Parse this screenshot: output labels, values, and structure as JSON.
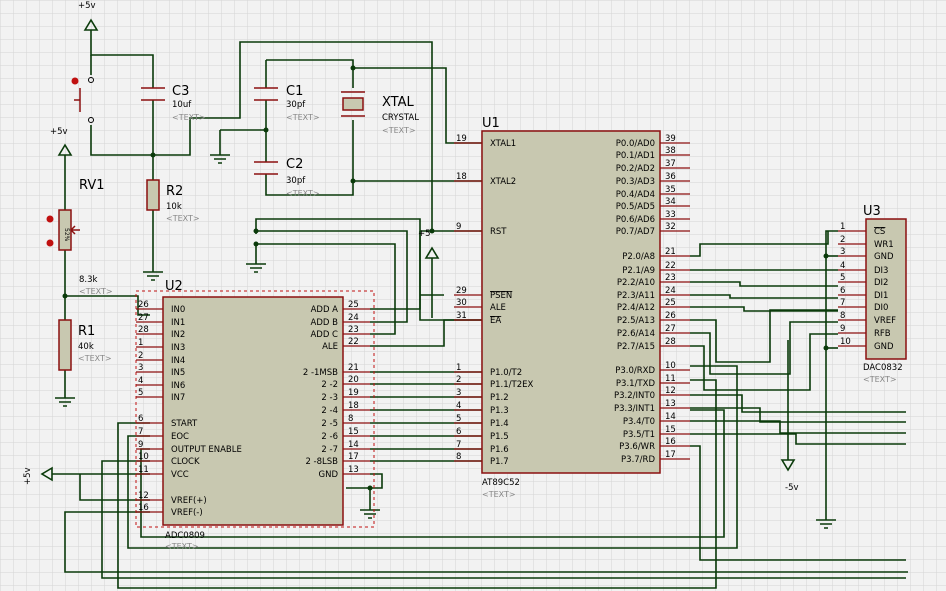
{
  "schematic": {
    "u1": {
      "ref": "U1",
      "part": "AT89C52",
      "text": "<TEXT>",
      "left_pins": [
        {
          "num": "19",
          "label": "XTAL1"
        },
        {
          "num": "18",
          "label": "XTAL2"
        },
        {
          "num": "9",
          "label": "RST"
        },
        {
          "num": "29",
          "label": "PSEN"
        },
        {
          "num": "30",
          "label": "ALE"
        },
        {
          "num": "31",
          "label": "EA"
        },
        {
          "num": "1",
          "label": "P1.0/T2"
        },
        {
          "num": "2",
          "label": "P1.1/T2EX"
        },
        {
          "num": "3",
          "label": "P1.2"
        },
        {
          "num": "4",
          "label": "P1.3"
        },
        {
          "num": "5",
          "label": "P1.4"
        },
        {
          "num": "6",
          "label": "P1.5"
        },
        {
          "num": "7",
          "label": "P1.6"
        },
        {
          "num": "8",
          "label": "P1.7"
        }
      ],
      "right_pins": [
        {
          "num": "39",
          "label": "P0.0/AD0"
        },
        {
          "num": "38",
          "label": "P0.1/AD1"
        },
        {
          "num": "37",
          "label": "P0.2/AD2"
        },
        {
          "num": "36",
          "label": "P0.3/AD3"
        },
        {
          "num": "35",
          "label": "P0.4/AD4"
        },
        {
          "num": "34",
          "label": "P0.5/AD5"
        },
        {
          "num": "33",
          "label": "P0.6/AD6"
        },
        {
          "num": "32",
          "label": "P0.7/AD7"
        },
        {
          "num": "21",
          "label": "P2.0/A8"
        },
        {
          "num": "22",
          "label": "P2.1/A9"
        },
        {
          "num": "23",
          "label": "P2.2/A10"
        },
        {
          "num": "24",
          "label": "P2.3/A11"
        },
        {
          "num": "25",
          "label": "P2.4/A12"
        },
        {
          "num": "26",
          "label": "P2.5/A13"
        },
        {
          "num": "27",
          "label": "P2.6/A14"
        },
        {
          "num": "28",
          "label": "P2.7/A15"
        },
        {
          "num": "10",
          "label": "P3.0/RXD"
        },
        {
          "num": "11",
          "label": "P3.1/TXD"
        },
        {
          "num": "12",
          "label": "P3.2/INT0"
        },
        {
          "num": "13",
          "label": "P3.3/INT1"
        },
        {
          "num": "14",
          "label": "P3.4/T0"
        },
        {
          "num": "15",
          "label": "P3.5/T1"
        },
        {
          "num": "16",
          "label": "P3.6/WR"
        },
        {
          "num": "17",
          "label": "P3.7/RD"
        }
      ]
    },
    "u2": {
      "ref": "U2",
      "part": "ADC0809",
      "text": "<TEXT>",
      "left_pins": [
        {
          "num": "26",
          "label": "IN0"
        },
        {
          "num": "27",
          "label": "IN1"
        },
        {
          "num": "28",
          "label": "IN2"
        },
        {
          "num": "1",
          "label": "IN3"
        },
        {
          "num": "2",
          "label": "IN4"
        },
        {
          "num": "3",
          "label": "IN5"
        },
        {
          "num": "4",
          "label": "IN6"
        },
        {
          "num": "5",
          "label": "IN7"
        },
        {
          "num": "6",
          "label": "START"
        },
        {
          "num": "7",
          "label": "EOC"
        },
        {
          "num": "9",
          "label": "OUTPUT ENABLE"
        },
        {
          "num": "10",
          "label": "CLOCK"
        },
        {
          "num": "11",
          "label": "VCC"
        },
        {
          "num": "12",
          "label": "VREF(+)"
        },
        {
          "num": "16",
          "label": "VREF(-)"
        }
      ],
      "right_pins": [
        {
          "num": "25",
          "label": "ADD A"
        },
        {
          "num": "24",
          "label": "ADD B"
        },
        {
          "num": "23",
          "label": "ADD C"
        },
        {
          "num": "22",
          "label": "ALE"
        },
        {
          "num": "21",
          "label": "2 -1MSB"
        },
        {
          "num": "20",
          "label": "2 -2"
        },
        {
          "num": "19",
          "label": "2 -3"
        },
        {
          "num": "18",
          "label": "2 -4"
        },
        {
          "num": "8",
          "label": "2 -5"
        },
        {
          "num": "15",
          "label": "2 -6"
        },
        {
          "num": "14",
          "label": "2 -7"
        },
        {
          "num": "17",
          "label": "2 -8LSB"
        },
        {
          "num": "13",
          "label": "GND"
        }
      ]
    },
    "u3": {
      "ref": "U3",
      "part": "DAC0832",
      "text": "<TEXT>",
      "pins": [
        {
          "num": "1",
          "label": "CS"
        },
        {
          "num": "2",
          "label": "WR1"
        },
        {
          "num": "3",
          "label": "GND"
        },
        {
          "num": "4",
          "label": "DI3"
        },
        {
          "num": "5",
          "label": "DI2"
        },
        {
          "num": "6",
          "label": "DI1"
        },
        {
          "num": "7",
          "label": "DI0"
        },
        {
          "num": "8",
          "label": "VREF"
        },
        {
          "num": "9",
          "label": "RFB"
        },
        {
          "num": "10",
          "label": "GND"
        }
      ]
    },
    "c3": {
      "ref": "C3",
      "value": "10uf",
      "text": "<TEXT>"
    },
    "c1": {
      "ref": "C1",
      "value": "30pf",
      "text": "<TEXT>"
    },
    "c2": {
      "ref": "C2",
      "value": "30pf",
      "text": "<TEXT>"
    },
    "xtal": {
      "ref": "XTAL",
      "value": "CRYSTAL",
      "text": "<TEXT>"
    },
    "r2": {
      "ref": "R2",
      "value": "10k",
      "text": "<TEXT>"
    },
    "r1": {
      "ref": "R1",
      "value": "40k",
      "text": "<TEXT>"
    },
    "rv1": {
      "ref": "RV1",
      "value": "8.3k",
      "text": "<TEXT>",
      "percent": "52%"
    },
    "power": {
      "p5v_top": "+5v",
      "p5v_left": "+5v",
      "p5v_mid": "+5",
      "p5v_rot": "+5v",
      "m5v": "-5v"
    }
  }
}
